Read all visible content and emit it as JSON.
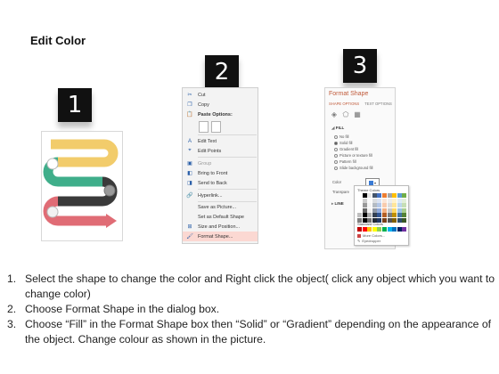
{
  "title": "Edit Color",
  "badges": [
    "1",
    "2",
    "3"
  ],
  "context_menu": {
    "items": [
      {
        "label": "Cut",
        "icon": "scissors-icon"
      },
      {
        "label": "Copy",
        "icon": "copy-icon"
      },
      {
        "label": "Paste Options:",
        "icon": "paste-icon"
      },
      {
        "label": "Edit Text",
        "icon": "edit-text-icon"
      },
      {
        "label": "Edit Points",
        "icon": "edit-points-icon"
      },
      {
        "label": "Group",
        "icon": "group-icon"
      },
      {
        "label": "Bring to Front",
        "icon": "bring-front-icon"
      },
      {
        "label": "Send to Back",
        "icon": "send-back-icon"
      },
      {
        "label": "Hyperlink...",
        "icon": "hyperlink-icon"
      },
      {
        "label": "Save as Picture...",
        "icon": ""
      },
      {
        "label": "Set as Default Shape",
        "icon": ""
      },
      {
        "label": "Size and Position...",
        "icon": "size-position-icon"
      },
      {
        "label": "Format Shape...",
        "icon": "format-shape-icon"
      }
    ]
  },
  "format_pane": {
    "title": "Format Shape",
    "tabs": [
      "SHAPE OPTIONS",
      "TEXT OPTIONS"
    ],
    "fill_section": "FILL",
    "fill_options": [
      "No fill",
      "Solid fill",
      "Gradient fill",
      "Picture or texture fill",
      "Pattern fill",
      "Slide background fill"
    ],
    "color_label": "Color",
    "transparency_label": "Transpare",
    "line_section": "LINE",
    "accent_color": "#3a7bd5"
  },
  "palette": {
    "theme_label": "Theme Colors",
    "standard_label": "Standard Colors",
    "more_label": "More Colors...",
    "eyedropper_label": "Eyedropper",
    "theme_colors": [
      "#ffffff",
      "#000000",
      "#e7e6e6",
      "#44546a",
      "#4472c4",
      "#ed7d31",
      "#a5a5a5",
      "#ffc000",
      "#5b9bd5",
      "#70ad47"
    ],
    "standard_colors": [
      "#c00000",
      "#ff0000",
      "#ffc000",
      "#ffff00",
      "#92d050",
      "#00b050",
      "#00b0f0",
      "#0070c0",
      "#002060",
      "#7030a0"
    ]
  },
  "shape_colors": {
    "yellow": "#f2cc6b",
    "green": "#3fae8a",
    "dark": "#3a3a3a",
    "red": "#e06c75"
  },
  "steps": [
    {
      "num": "1.",
      "text": "Select the shape to change the color and Right click the object( click any object which you want to change color)"
    },
    {
      "num": "2.",
      "text": "Choose Format Shape in the dialog box."
    },
    {
      "num": "3.",
      "text": "Choose “Fill” in the Format Shape box then “Solid” or “Gradient” depending on the appearance of the object. Change colour as shown in the picture."
    }
  ]
}
